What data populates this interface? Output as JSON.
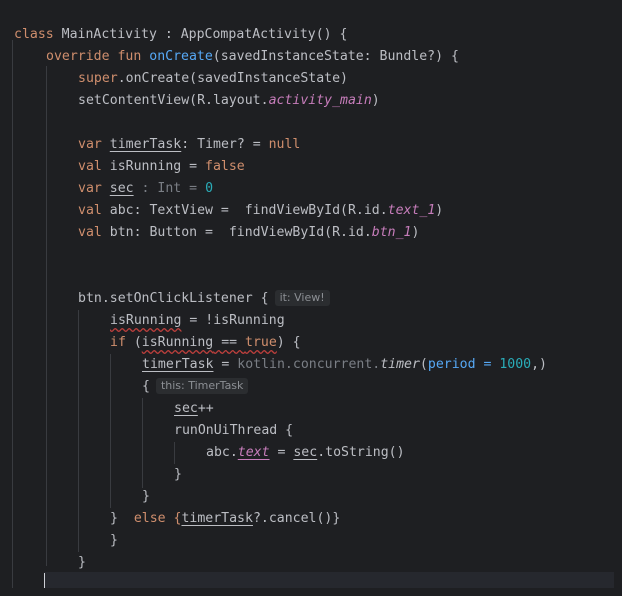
{
  "code": {
    "l1_class": "class",
    "l1_name": " MainActivity : AppCompatActivity() {",
    "l2_override": "override",
    "l2_fun": "fun",
    "l2_oncreate": "onCreate",
    "l2_rest": "(savedInstanceState: Bundle?) {",
    "l3_super": "super",
    "l3_rest": ".onCreate(savedInstanceState)",
    "l4_pre": "setContentView(R.layout.",
    "l4_prop": "activity_main",
    "l4_post": ")",
    "l5_var": "var",
    "l5_name": "timerTask",
    "l5_mid": ": Timer? = ",
    "l5_null": "null",
    "l6_val": "val",
    "l6_mid": " isRunning = ",
    "l6_false": "false",
    "l7_var": "var",
    "l7_name": "sec",
    "l7_type": " : Int = ",
    "l7_num": "0",
    "l8_val": "val",
    "l8_mid": " abc: TextView =  findViewById(R.id.",
    "l8_prop": "text_1",
    "l8_post": ")",
    "l9_val": "val",
    "l9_mid": " btn: Button =  findViewById(R.id.",
    "l9_prop": "btn_1",
    "l9_post": ")",
    "l10_pre": "btn.setOnClickListener {",
    "l10_hint": "it: View!",
    "l11_name": "isRunning",
    "l11_rest": " = !isRunning",
    "l12_if": "if",
    "l12_open": " (",
    "l12_name": "isRunning",
    "l12_eq": " == ",
    "l12_true": "true",
    "l12_close": ") {",
    "l13_name": "timerTask",
    "l13_eq": " = ",
    "l13_pkg": "kotlin.concurrent.",
    "l13_timer": "timer",
    "l13_paren": "(",
    "l13_param": "period = ",
    "l13_num": "1000",
    "l13_end": ",)",
    "l14_brace": "{",
    "l14_hint": "this: TimerTask",
    "l15_name": "sec",
    "l15_op": "++",
    "l16_text": "runOnUiThread {",
    "l17_abc": "abc.",
    "l17_text": "text",
    "l17_eq": " = ",
    "l17_sec": "sec",
    "l17_rest": ".toString()",
    "l18_brace": "}",
    "l19_brace": "}",
    "l20_close": "}",
    "l20_else": "  else {",
    "l20_name": "timerTask",
    "l20_rest": "?.cancel()}",
    "l21_brace": "}",
    "l22_brace": "}"
  },
  "colors": {
    "background": "#1e1f22",
    "keyword": "#cf8e6d",
    "function": "#56a8f5",
    "number": "#2aacb8",
    "property": "#c77dbb",
    "text": "#bcbec4"
  }
}
